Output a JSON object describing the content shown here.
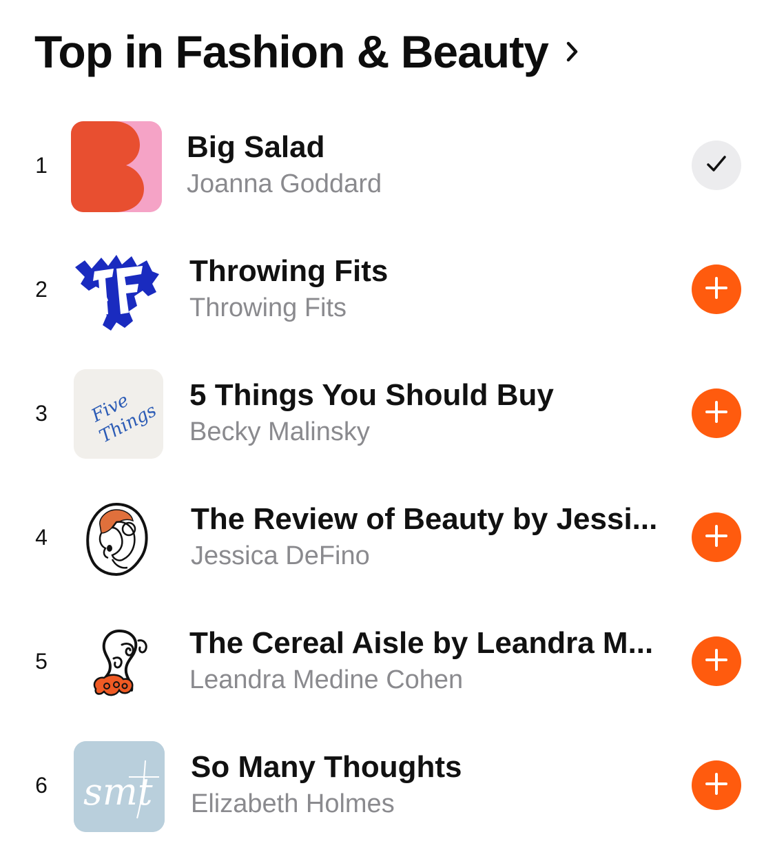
{
  "section": {
    "title": "Top in Fashion & Beauty"
  },
  "colors": {
    "accent": "#ff5b0e",
    "subscribed_bg": "#ececee",
    "subtitle": "#8a8a8e"
  },
  "items": [
    {
      "rank": "1",
      "title": "Big Salad",
      "author": "Joanna Goddard",
      "status": "subscribed",
      "action_icon": "checkmark-icon"
    },
    {
      "rank": "2",
      "title": "Throwing Fits",
      "author": "Throwing Fits",
      "status": "not-subscribed",
      "action_icon": "plus-icon"
    },
    {
      "rank": "3",
      "title": "5 Things You Should Buy",
      "author": "Becky Malinsky",
      "status": "not-subscribed",
      "action_icon": "plus-icon",
      "artwork_text": [
        "Five",
        "Things"
      ]
    },
    {
      "rank": "4",
      "title": "The Review of Beauty by Jessi...",
      "author": "Jessica DeFino",
      "status": "not-subscribed",
      "action_icon": "plus-icon"
    },
    {
      "rank": "5",
      "title": "The Cereal Aisle by Leandra M...",
      "author": "Leandra Medine Cohen",
      "status": "not-subscribed",
      "action_icon": "plus-icon"
    },
    {
      "rank": "6",
      "title": "So Many Thoughts",
      "author": "Elizabeth Holmes",
      "status": "not-subscribed",
      "action_icon": "plus-icon",
      "artwork_text": "smt"
    }
  ]
}
